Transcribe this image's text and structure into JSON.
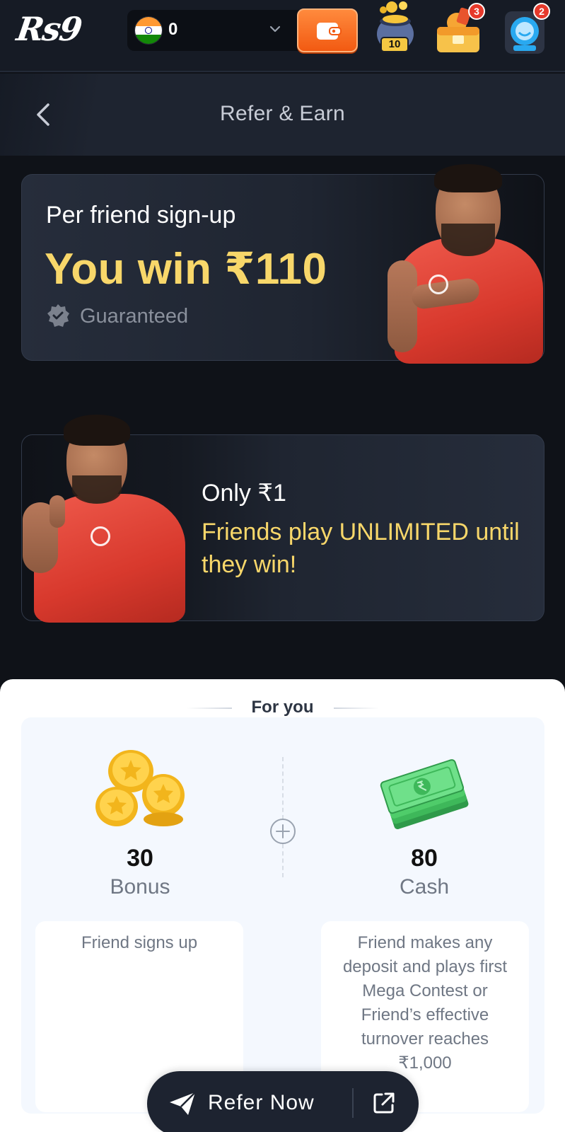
{
  "app": {
    "logo_text": "Rs9",
    "balance": {
      "value": "0",
      "country_flag": "india-flag-icon"
    },
    "badges": {
      "rewards": "3",
      "support": "2"
    },
    "jackpot_label": "10"
  },
  "header": {
    "title": "Refer & Earn"
  },
  "promo1": {
    "title": "Per friend sign-up",
    "amount": "You win ₹110",
    "guaranteed": "Guaranteed"
  },
  "promo2": {
    "title": "Only ₹1",
    "subtitle": "Friends play UNLIMITED until they win!"
  },
  "for_you": {
    "title": "For you",
    "rewards": [
      {
        "value": "30",
        "label": "Bonus",
        "icon": "coins-icon",
        "condition": "Friend signs up"
      },
      {
        "value": "80",
        "label": "Cash",
        "icon": "cash-stack-icon",
        "condition": "Friend makes any deposit and plays first Mega Contest or Friend’s effective turnover reaches ₹1,000"
      }
    ]
  },
  "refer_button": {
    "label": "Refer Now"
  },
  "colors": {
    "background": "#0f1218",
    "accent_gold": "#f8d76a",
    "wallet_orange": "#f25a12",
    "badge_red": "#e6392b"
  }
}
